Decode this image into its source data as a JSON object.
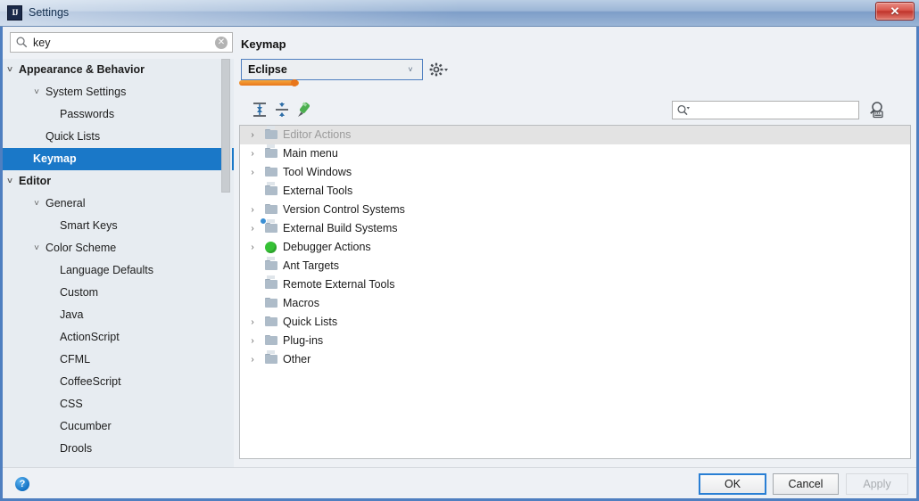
{
  "window": {
    "title": "Settings",
    "icon": "intellij-idea-icon",
    "close_label": "✕"
  },
  "sidebar": {
    "search": {
      "value": "key",
      "placeholder": "",
      "icon": "search-icon",
      "clear_icon": "✕"
    },
    "items": [
      {
        "label": "Appearance & Behavior",
        "indent": 18,
        "chevron": "˅",
        "bold": true,
        "selected": false
      },
      {
        "label": "System Settings",
        "indent": 48,
        "chevron": "˅",
        "bold": false,
        "selected": false
      },
      {
        "label": "Passwords",
        "indent": 64,
        "chevron": "",
        "bold": false,
        "selected": false
      },
      {
        "label": "Quick Lists",
        "indent": 48,
        "chevron": "",
        "bold": false,
        "selected": false
      },
      {
        "label": "Keymap",
        "indent": 34,
        "chevron": "",
        "bold": true,
        "selected": true
      },
      {
        "label": "Editor",
        "indent": 18,
        "chevron": "˅",
        "bold": true,
        "selected": false
      },
      {
        "label": "General",
        "indent": 48,
        "chevron": "˅",
        "bold": false,
        "selected": false
      },
      {
        "label": "Smart Keys",
        "indent": 64,
        "chevron": "",
        "bold": false,
        "selected": false
      },
      {
        "label": "Color Scheme",
        "indent": 48,
        "chevron": "˅",
        "bold": false,
        "selected": false
      },
      {
        "label": "Language Defaults",
        "indent": 64,
        "chevron": "",
        "bold": false,
        "selected": false
      },
      {
        "label": "Custom",
        "indent": 64,
        "chevron": "",
        "bold": false,
        "selected": false
      },
      {
        "label": "Java",
        "indent": 64,
        "chevron": "",
        "bold": false,
        "selected": false
      },
      {
        "label": "ActionScript",
        "indent": 64,
        "chevron": "",
        "bold": false,
        "selected": false
      },
      {
        "label": "CFML",
        "indent": 64,
        "chevron": "",
        "bold": false,
        "selected": false
      },
      {
        "label": "CoffeeScript",
        "indent": 64,
        "chevron": "",
        "bold": false,
        "selected": false
      },
      {
        "label": "CSS",
        "indent": 64,
        "chevron": "",
        "bold": false,
        "selected": false
      },
      {
        "label": "Cucumber",
        "indent": 64,
        "chevron": "",
        "bold": false,
        "selected": false
      },
      {
        "label": "Drools",
        "indent": 64,
        "chevron": "",
        "bold": false,
        "selected": false
      }
    ]
  },
  "main": {
    "title": "Keymap",
    "keymap_select": {
      "value": "Eclipse",
      "arrow": "˅"
    },
    "gear_icon": "gear-icon",
    "toolbar": {
      "expand_all_icon": "expand-all-icon",
      "collapse_all_icon": "collapse-all-icon",
      "edit_shortcut_icon": "edit-shortcut-icon"
    },
    "find_field": {
      "value": "",
      "placeholder": "",
      "icon": "search-dropdown-icon"
    },
    "find_by_shortcut_icon": "find-by-shortcut-icon",
    "actions": [
      {
        "label": "Editor Actions",
        "chevron": "›",
        "icon": "editor-actions-icon",
        "selected": true
      },
      {
        "label": "Main menu",
        "chevron": "›",
        "icon": "main-menu-icon",
        "selected": false
      },
      {
        "label": "Tool Windows",
        "chevron": "›",
        "icon": "folder-icon",
        "selected": false
      },
      {
        "label": "External Tools",
        "chevron": "",
        "icon": "external-tools-icon",
        "selected": false
      },
      {
        "label": "Version Control Systems",
        "chevron": "›",
        "icon": "folder-icon",
        "selected": false
      },
      {
        "label": "External Build Systems",
        "chevron": "›",
        "icon": "external-build-icon",
        "selected": false
      },
      {
        "label": "Debugger Actions",
        "chevron": "›",
        "icon": "debugger-bug-icon",
        "selected": false
      },
      {
        "label": "Ant Targets",
        "chevron": "",
        "icon": "ant-targets-icon",
        "selected": false
      },
      {
        "label": "Remote External Tools",
        "chevron": "",
        "icon": "remote-external-tools-icon",
        "selected": false
      },
      {
        "label": "Macros",
        "chevron": "",
        "icon": "folder-icon",
        "selected": false
      },
      {
        "label": "Quick Lists",
        "chevron": "›",
        "icon": "folder-icon",
        "selected": false
      },
      {
        "label": "Plug-ins",
        "chevron": "›",
        "icon": "folder-icon",
        "selected": false
      },
      {
        "label": "Other",
        "chevron": "›",
        "icon": "other-icon",
        "selected": false
      }
    ]
  },
  "footer": {
    "help_icon": "?",
    "ok_label": "OK",
    "cancel_label": "Cancel",
    "apply_label": "Apply"
  },
  "colors": {
    "selection_blue": "#1a78c8",
    "focus_blue": "#2a7fd4",
    "highlight_orange": "#e8761b",
    "close_red": "#c0342c"
  }
}
